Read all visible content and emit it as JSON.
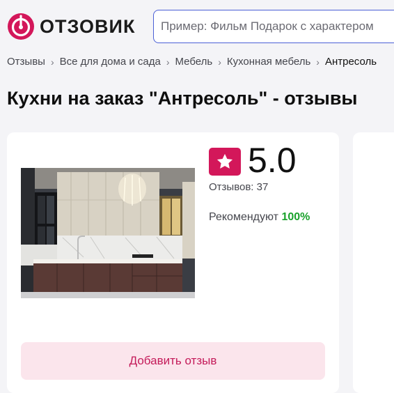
{
  "brand": {
    "logo_text": "ОТЗОВИК",
    "accent_color": "#d3175a"
  },
  "search": {
    "placeholder": "Пример: Фильм Подарок с характером"
  },
  "breadcrumb": {
    "items": [
      "Отзывы",
      "Все для дома и сада",
      "Мебель",
      "Кухонная мебель",
      "Антресоль"
    ]
  },
  "page": {
    "title": "Кухни на заказ \"Антресоль\" - отзывы"
  },
  "product": {
    "image_icon": "kitchen-photo",
    "rating_icon": "star-icon",
    "rating": "5.0",
    "reviews_count": "Отзывов: 37",
    "recommend_label": "Рекомендуют",
    "recommend_value": "100%",
    "recommend_color": "#1aa22c",
    "add_review_label": "Добавить отзыв"
  }
}
